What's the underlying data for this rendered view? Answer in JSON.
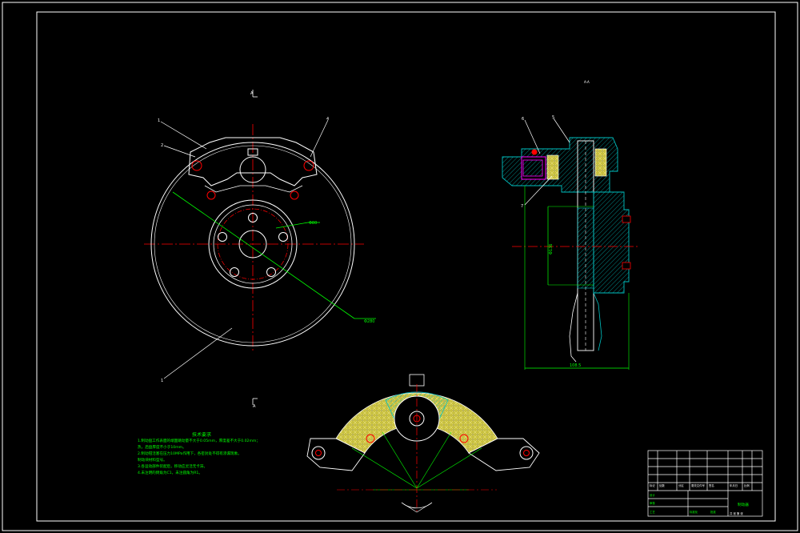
{
  "view_labels": {
    "section_top": "A",
    "section_bottom": "A",
    "side_view_mark": "A-A"
  },
  "balloons": [
    "1",
    "2",
    "3",
    "4",
    "5",
    "6",
    "7"
  ],
  "dimensions": {
    "bolt_circle": "Φ80",
    "disc_outer": "Φ280",
    "hub_bore": "Φ136",
    "overall_width": "108.5"
  },
  "technical_requirements": {
    "heading": "技术要求",
    "items": [
      "1.制动盘工作表面的端面跳动量不大于0.05mm，厚度差不大于0.02mm；",
      "热，后盘厚度不小于10mm。",
      "2.制动钳活塞在压力10MPa作用下，各密封处不得有渗漏现象。",
      "制动块材料型号。",
      "3.各运动部件装配后，移动应灵活无卡滞。",
      "4.未注明的倒角为C1，未注圆角为R1。"
    ]
  },
  "title_block": {
    "drawing_title": "制动器",
    "rows": [
      "标记",
      "处数",
      "分区",
      "更改文件号",
      "签名",
      "年月日"
    ],
    "labels": [
      "设计",
      "审核",
      "工艺",
      "标准化",
      "批准"
    ],
    "scale_label": "比例",
    "sheet_label": "共 张 第 张"
  },
  "colors": {
    "background": "#000000",
    "outline": "#ffffff",
    "centerline": "#ff0000",
    "dimension": "#00ff00",
    "hatch": "#00c0c0",
    "friction_material": "#e8e060",
    "piston": "#ff00ff"
  }
}
